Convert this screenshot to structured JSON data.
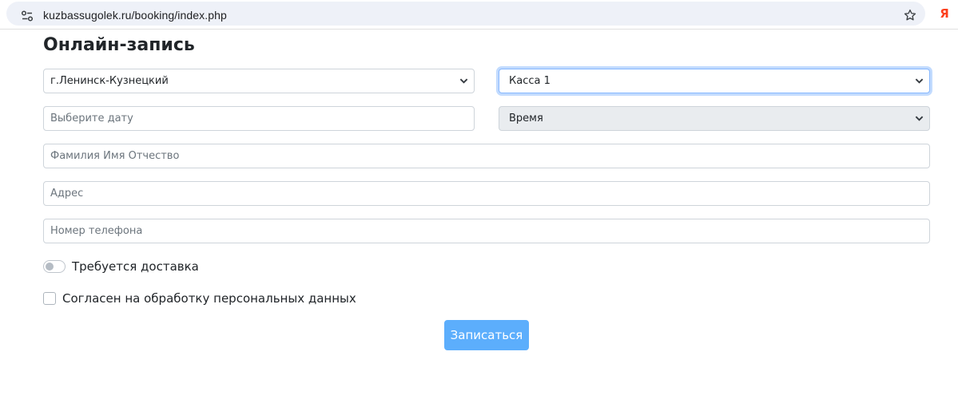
{
  "browser": {
    "url": "kuzbassugolek.ru/booking/index.php",
    "site_info_icon": "tune-icon",
    "bookmark_icon": "star-outline-icon",
    "extension_icon": "yandex-icon",
    "extension_glyph": "Я"
  },
  "page": {
    "title": "Онлайн-запись"
  },
  "form": {
    "city_select": {
      "value": "г.Ленинск-Кузнецкий"
    },
    "office_select": {
      "value": "Касса 1"
    },
    "date_input": {
      "placeholder": "Выберите дату",
      "value": ""
    },
    "time_select": {
      "value": "Время",
      "disabled": true
    },
    "name_input": {
      "placeholder": "Фамилия Имя Отчество",
      "value": ""
    },
    "address_input": {
      "placeholder": "Адрес",
      "value": ""
    },
    "phone_input": {
      "placeholder": "Номер телефона",
      "value": ""
    },
    "delivery_switch": {
      "label": "Требуется доставка",
      "checked": false
    },
    "consent_checkbox": {
      "label": "Согласен на обработку персональных данных",
      "checked": false
    },
    "submit_label": "Записаться"
  },
  "colors": {
    "accent": "#5caefc",
    "focus_ring": "#86b7fe",
    "border": "#ced4da",
    "disabled_bg": "#e9ecef",
    "placeholder": "#6c757d"
  }
}
